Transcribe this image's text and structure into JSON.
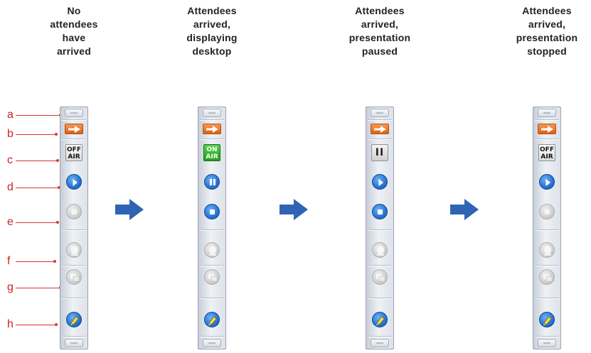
{
  "labels": [
    "a",
    "b",
    "c",
    "d",
    "e",
    "f",
    "g",
    "h"
  ],
  "panels": [
    {
      "heading": [
        "No",
        "attendees",
        "have",
        "arrived"
      ],
      "air_text": [
        "OFF",
        "AIR"
      ],
      "air_state": "off",
      "pause_active": false,
      "play_active": true,
      "stop_active": false
    },
    {
      "heading": [
        "Attendees",
        "arrived,",
        "displaying",
        "desktop"
      ],
      "air_text": [
        "ON",
        "AIR"
      ],
      "air_state": "on",
      "pause_active": true,
      "play_active": false,
      "stop_active": true
    },
    {
      "heading": [
        "Attendees",
        "arrived,",
        "presentation",
        "paused"
      ],
      "air_text": [
        "II",
        ""
      ],
      "air_state": "paused",
      "pause_active": false,
      "play_active": true,
      "stop_active": true
    },
    {
      "heading": [
        "Attendees",
        "arrived,",
        "presentation",
        "stopped"
      ],
      "air_text": [
        "OFF",
        "AIR"
      ],
      "air_state": "off",
      "pause_active": false,
      "play_active": true,
      "stop_active": false
    }
  ],
  "colors": {
    "label_red": "#cc2222",
    "flow_arrow_blue": "#2f64b4",
    "on_air_green": "#1f9e1a",
    "action_orange": "#dc5f14",
    "active_blue": "#2a78d8"
  }
}
